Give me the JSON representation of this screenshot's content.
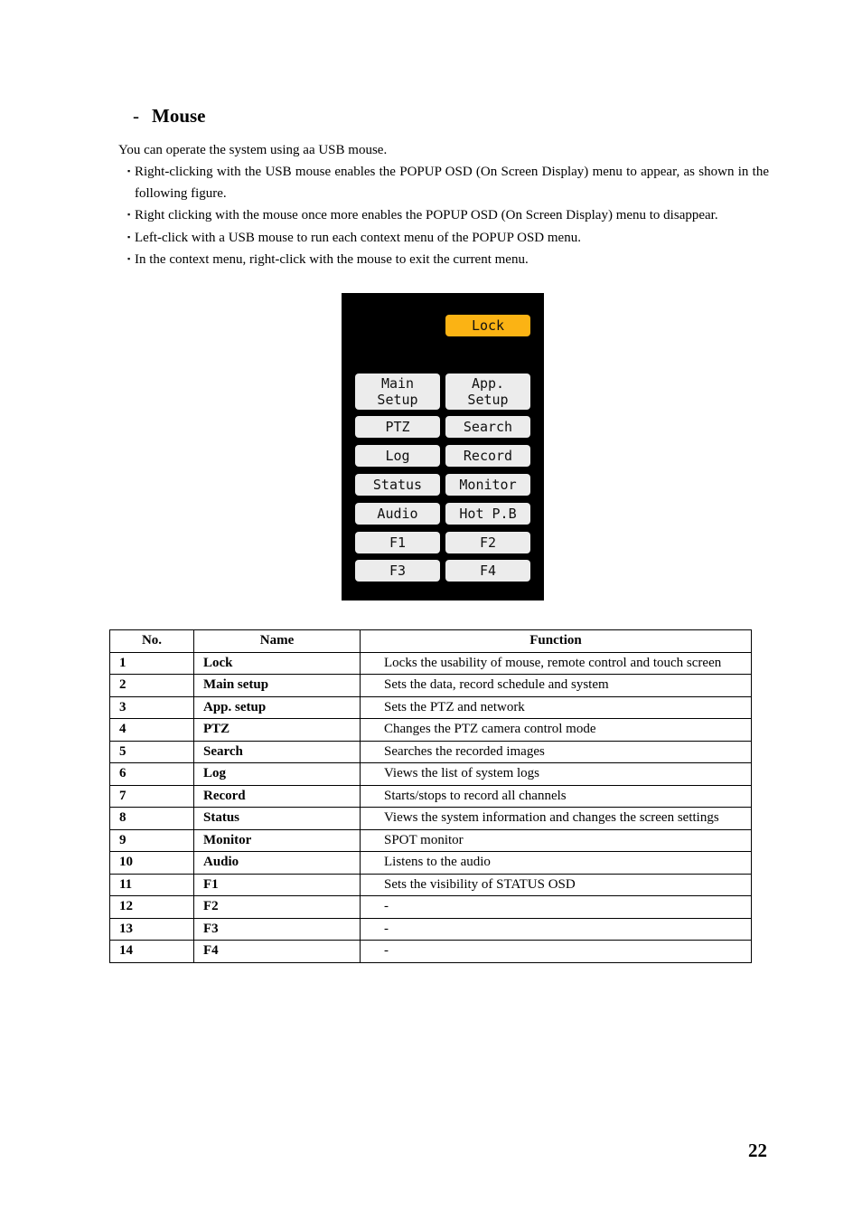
{
  "heading": {
    "dash": "-",
    "title": "Mouse"
  },
  "intro": "You can operate the system using aa USB mouse.",
  "bullet_mark": "▪",
  "bullets": [
    "Right-clicking with the USB mouse enables the POPUP OSD (On Screen Display) menu to appear, as shown in the following figure.",
    "Right clicking with the mouse once more enables the POPUP OSD (On Screen Display) menu to disappear.",
    "Left-click with a USB mouse to run each context menu of the POPUP OSD menu.",
    "In the context menu, right-click with the mouse to exit the current menu."
  ],
  "osd_menu": {
    "colors": {
      "background": "#000000",
      "button": "#ececec",
      "active": "#fbb314"
    },
    "lock": "Lock",
    "buttons": [
      "Main\nSetup",
      "App.\nSetup",
      "PTZ",
      "Search",
      "Log",
      "Record",
      "Status",
      "Monitor",
      "Audio",
      "Hot P.B",
      "F1",
      "F2",
      "F3",
      "F4"
    ]
  },
  "table": {
    "headers": [
      "No.",
      "Name",
      "Function"
    ],
    "rows": [
      {
        "no": "1",
        "name": "Lock",
        "function": "Locks the usability of mouse, remote control and touch screen"
      },
      {
        "no": "2",
        "name": "Main setup",
        "function": "Sets the data, record schedule and system"
      },
      {
        "no": "3",
        "name": "App. setup",
        "function": "Sets the PTZ and network"
      },
      {
        "no": "4",
        "name": "PTZ",
        "function": "Changes the PTZ camera control mode"
      },
      {
        "no": "5",
        "name": "Search",
        "function": "Searches the recorded images"
      },
      {
        "no": "6",
        "name": "Log",
        "function": "Views the list of system logs"
      },
      {
        "no": "7",
        "name": "Record",
        "function": "Starts/stops to record all channels"
      },
      {
        "no": "8",
        "name": "Status",
        "function": "Views the system information and changes the screen settings"
      },
      {
        "no": "9",
        "name": "Monitor",
        "function": "SPOT monitor"
      },
      {
        "no": "10",
        "name": "Audio",
        "function": "Listens to the audio"
      },
      {
        "no": "11",
        "name": "F1",
        "function": "Sets the visibility of STATUS OSD"
      },
      {
        "no": "12",
        "name": "F2",
        "function": "-"
      },
      {
        "no": "13",
        "name": "F3",
        "function": "-"
      },
      {
        "no": "14",
        "name": "F4",
        "function": "-"
      }
    ]
  },
  "page_number": "22"
}
